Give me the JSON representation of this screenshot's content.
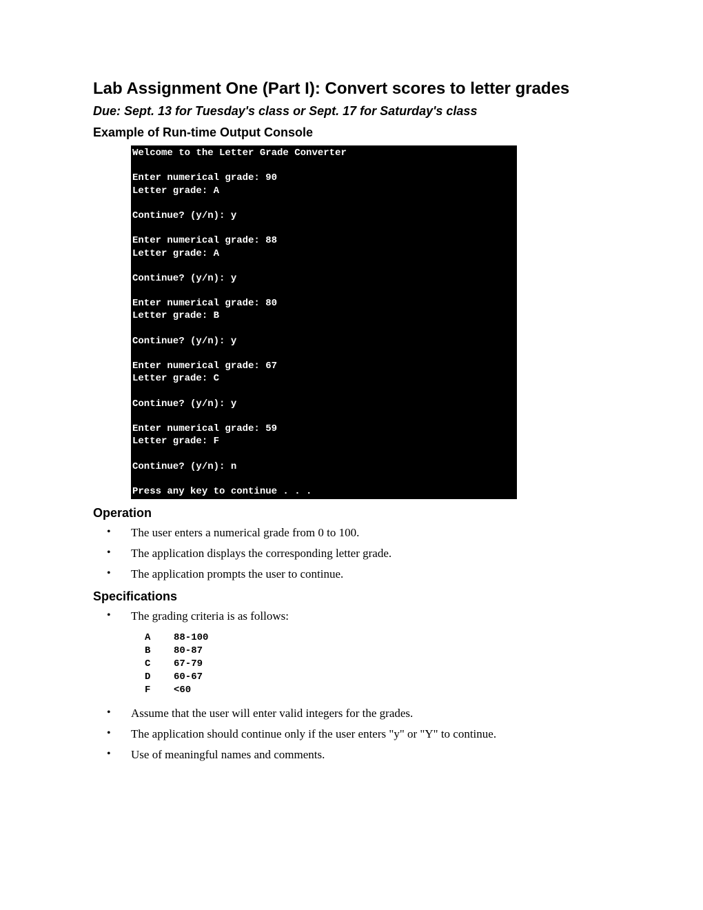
{
  "title": "Lab Assignment One (Part I):  Convert scores to letter grades",
  "due": "Due:  Sept. 13 for Tuesday's class or Sept. 17 for Saturday's class",
  "console_heading": "Example of Run-time Output Console",
  "console_text": "Welcome to the Letter Grade Converter\n\nEnter numerical grade: 90\nLetter grade: A\n\nContinue? (y/n): y\n\nEnter numerical grade: 88\nLetter grade: A\n\nContinue? (y/n): y\n\nEnter numerical grade: 80\nLetter grade: B\n\nContinue? (y/n): y\n\nEnter numerical grade: 67\nLetter grade: C\n\nContinue? (y/n): y\n\nEnter numerical grade: 59\nLetter grade: F\n\nContinue? (y/n): n\n\nPress any key to continue . . .",
  "operation_heading": "Operation",
  "operation_items": [
    "The user enters a numerical grade from 0 to 100.",
    "The application displays the corresponding letter grade.",
    "The application prompts the user to continue."
  ],
  "specifications_heading": "Specifications",
  "spec_item_0": "The grading criteria is as follows:",
  "grade_table": "A    88-100\nB    80-87\nC    67-79\nD    60-67\nF    <60",
  "spec_item_1": "Assume that the user will enter valid integers for the grades.",
  "spec_item_2": "The application should continue only if the user enters \"y\" or \"Y\" to continue.",
  "spec_item_3": "Use of meaningful names and comments."
}
